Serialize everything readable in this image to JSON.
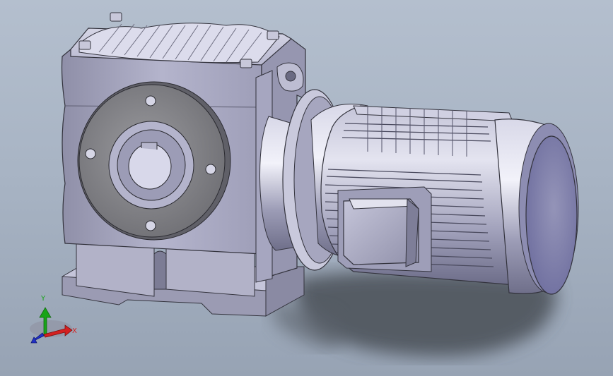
{
  "viewport": {
    "background_top": "#b4bfce",
    "background_bottom": "#97a3b4"
  },
  "triad": {
    "x_label": "X",
    "y_label": "Y",
    "x_color": "#d42020",
    "y_color": "#18a418",
    "z_color": "#2030c8"
  },
  "model": {
    "body_color": "#a9a9c2",
    "flange_color": "#8a8a8f",
    "shadow_color": "#4a4f57"
  }
}
